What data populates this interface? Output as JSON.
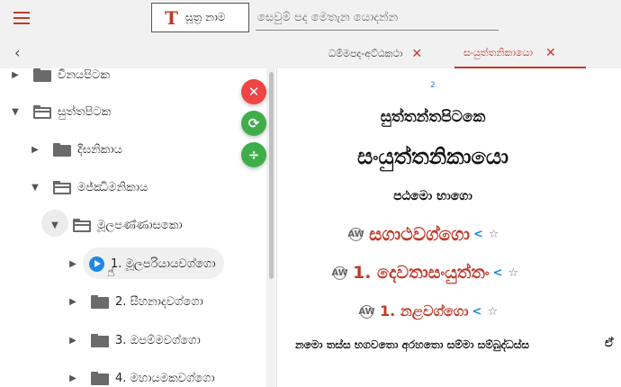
{
  "topbar": {
    "menu_icon": "hamburger-menu-icon",
    "t_button_icon": "T",
    "t_button_label": "සූත්‍ර නාම",
    "search_placeholder": "සෙවුම් පද මෙතැන යොදන්න"
  },
  "tabs": [
    {
      "label": "ධම්මපද-අට්ඨකථා",
      "active": false
    },
    {
      "label": "සංයුත්තනිකායො",
      "active": true
    }
  ],
  "tree": [
    {
      "label": "විනයපිටක",
      "expanded": false,
      "level": 0
    },
    {
      "label": "සුත්තපිටක",
      "expanded": true,
      "level": 0
    },
    {
      "label": "දීඝනිකාය",
      "expanded": false,
      "level": 1
    },
    {
      "label": "මජ්ඣිමනිකාය",
      "expanded": true,
      "level": 1
    },
    {
      "label": "මූලපණ්ණාසකො",
      "expanded": true,
      "level": 2
    },
    {
      "label": "1. මූලපරියායවග්ගො",
      "expanded": false,
      "level": 3,
      "selected": true
    },
    {
      "label": "2. සීහනාදවග්ගො",
      "expanded": false,
      "level": 3
    },
    {
      "label": "3. ඔපම්මවග්ගො",
      "expanded": false,
      "level": 3
    },
    {
      "label": "4. මහායමකවග්ගො",
      "expanded": false,
      "level": 3
    }
  ],
  "fabs": [
    {
      "label": "✕",
      "icon": "close-icon",
      "color": "#ef4545"
    },
    {
      "label": "⟳",
      "icon": "refresh-icon",
      "color": "#3fae4a"
    },
    {
      "label": "÷",
      "icon": "divide-icon",
      "color": "#3fae4a"
    }
  ],
  "content": {
    "page_number": "2",
    "pitaka": "සුත්තන්තපිටකෙ",
    "nikaya": "සංයුත්තනිකායො",
    "bhaga": "පඨමො භාගො",
    "vagga": "සගාථවග්ගො",
    "samyutta": "1. දෙවතාසංයුත්තං",
    "sub_vagga": "1. නළවග්ගො",
    "homage": "නමො තස්ස භගවතො අරහතො සම්මා සම්බුද්ධස්ස",
    "homage_tail": "ඒ",
    "aw_label": "AW"
  },
  "colors": {
    "accent": "#c0392b",
    "link": "#1e88e5"
  }
}
